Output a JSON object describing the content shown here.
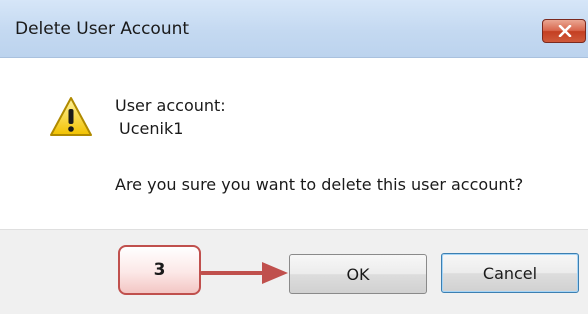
{
  "dialog": {
    "title": "Delete User Account",
    "close_icon": "close-icon",
    "warning_icon": "warning-icon",
    "message_label": "User account:",
    "account_name": "Ucenik1",
    "question": "Are you sure you want to delete this user account?"
  },
  "buttons": {
    "ok_label": "OK",
    "cancel_label": "Cancel"
  },
  "annotation": {
    "step_number": "3",
    "color": "#c0504d"
  }
}
